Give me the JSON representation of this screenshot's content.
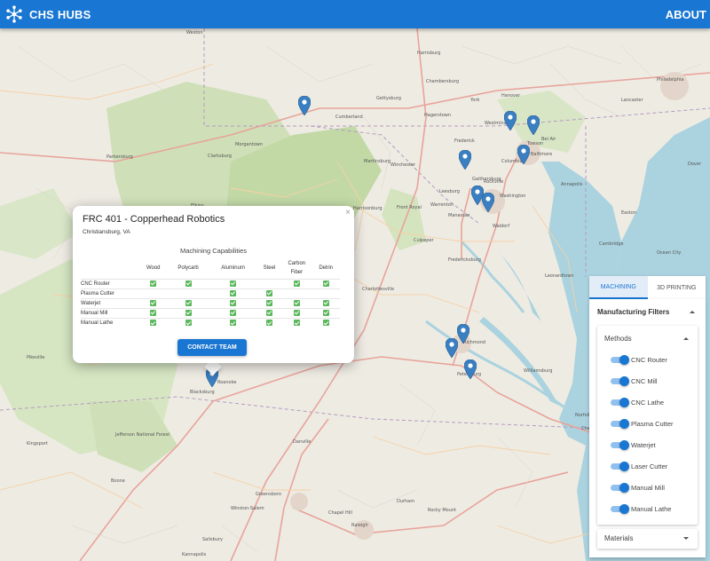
{
  "app": {
    "title": "CHS HUBS",
    "about_label": "ABOUT",
    "brand_color": "#1976d2"
  },
  "map": {
    "place_labels": [
      "Weston",
      "Morgantown",
      "Cumberland",
      "Hagerstown",
      "Frederick",
      "Winchester",
      "Baltimore",
      "Washington",
      "Columbia",
      "Westminster",
      "Towson",
      "Leesburg",
      "Gaithersburg",
      "Manassas",
      "Fredericksburg",
      "Charlottesville",
      "Richmond",
      "Petersburg",
      "Lynchburg",
      "Roanoke",
      "Danville",
      "Greensboro",
      "Raleigh",
      "Norfolk",
      "Virginia Beach",
      "Chesapeake",
      "Annapolis",
      "Dover",
      "Lancaster",
      "York",
      "Harrisburg",
      "Philadelphia",
      "Parkersburg",
      "Clarksburg",
      "Elkins",
      "Staunton",
      "Harrisonburg",
      "Blacksburg",
      "Durham",
      "Chapel Hill",
      "Rocky Mount",
      "Williamsburg",
      "Kingsport",
      "Jefferson National Forest",
      "Boone",
      "Winston-Salem",
      "Salisbury",
      "Kannapolis",
      "Pikeville",
      "Chambersburg",
      "Hanover",
      "Waldorf",
      "Easton",
      "Ocean City",
      "Cambridge",
      "Leonardtown",
      "Martinsburg",
      "Front Royal",
      "Culpeper",
      "Warrenton",
      "Gettysburg",
      "Elizabeth City",
      "Rockville",
      "Bel Air"
    ],
    "marker_color": "#3a7fc2"
  },
  "popup": {
    "title": "FRC 401 - Copperhead Robotics",
    "location": "Christiansburg, VA",
    "capabilities_title": "Machining Capabilities",
    "columns": [
      "Wood",
      "Polycarb",
      "Aluminum",
      "Steel",
      "Carbon Fiber",
      "Delrin"
    ],
    "rows": [
      {
        "label": "CNC Router",
        "checks": [
          true,
          true,
          true,
          false,
          true,
          true
        ]
      },
      {
        "label": "Plasma Cutter",
        "checks": [
          false,
          false,
          true,
          true,
          false,
          false
        ]
      },
      {
        "label": "Waterjet",
        "checks": [
          true,
          true,
          true,
          true,
          true,
          true
        ]
      },
      {
        "label": "Manual Mill",
        "checks": [
          true,
          true,
          true,
          true,
          true,
          true
        ]
      },
      {
        "label": "Manual Lathe",
        "checks": [
          true,
          true,
          true,
          true,
          true,
          true
        ]
      }
    ],
    "contact_label": "CONTACT TEAM",
    "close_symbol": "×",
    "check_color": "#5cb85c"
  },
  "filters": {
    "tabs": [
      {
        "label": "MACHINING",
        "active": true
      },
      {
        "label": "3D PRINTING",
        "active": false
      }
    ],
    "heading": "Manufacturing Filters",
    "methods_label": "Methods",
    "methods": [
      {
        "label": "CNC Router",
        "on": true
      },
      {
        "label": "CNC Mill",
        "on": true
      },
      {
        "label": "CNC Lathe",
        "on": true
      },
      {
        "label": "Plasma Cutter",
        "on": true
      },
      {
        "label": "Waterjet",
        "on": true
      },
      {
        "label": "Laser Cutter",
        "on": true
      },
      {
        "label": "Manual Mill",
        "on": true
      },
      {
        "label": "Manual Lathe",
        "on": true
      }
    ],
    "materials_label": "Materials"
  }
}
